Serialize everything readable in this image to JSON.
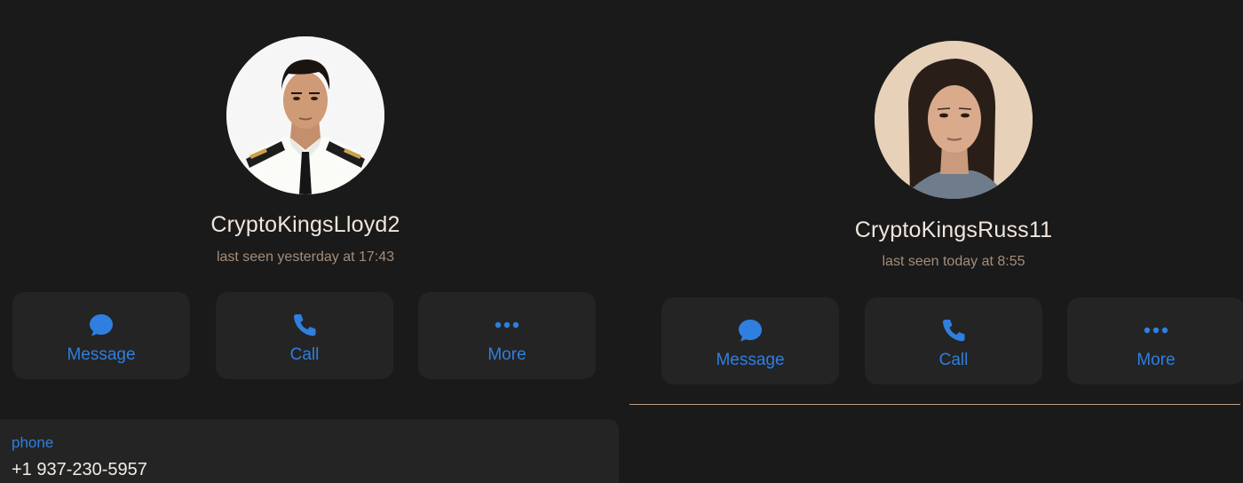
{
  "contacts": [
    {
      "name": "CryptoKingsLloyd2",
      "status": "last seen yesterday at 17:43",
      "actions": [
        {
          "label": "Message",
          "icon": "message-bubble-icon"
        },
        {
          "label": "Call",
          "icon": "phone-icon"
        },
        {
          "label": "More",
          "icon": "more-dots-icon"
        }
      ],
      "info": {
        "label": "phone",
        "value": "+1 937-230-5957"
      }
    },
    {
      "name": "CryptoKingsRuss11",
      "status": "last seen today at 8:55",
      "actions": [
        {
          "label": "Message",
          "icon": "message-bubble-icon"
        },
        {
          "label": "Call",
          "icon": "phone-icon"
        },
        {
          "label": "More",
          "icon": "more-dots-icon"
        }
      ]
    }
  ],
  "colors": {
    "background": "#1a1a1a",
    "button_background": "#242424",
    "accent": "#2f7fe0",
    "name_text": "#f2e6dc",
    "status_text": "#a58d7a"
  }
}
